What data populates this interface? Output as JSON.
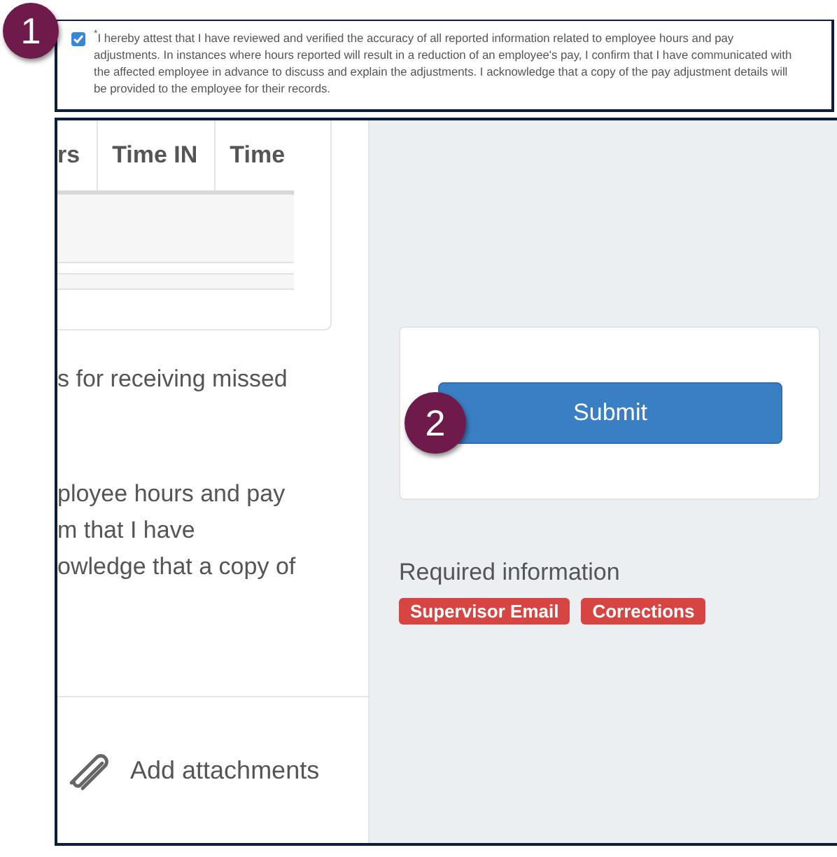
{
  "annotations": [
    {
      "label": "1"
    },
    {
      "label": "2"
    }
  ],
  "attestation": {
    "checked": true,
    "required_mark": "*",
    "text": "I hereby attest that I have reviewed and verified the accuracy of all reported information related to employee hours and pay adjustments. In instances where hours reported will result in a reduction of an employee's pay, I confirm that I have communicated with the affected employee in advance to discuss and explain the adjustments. I acknowledge that a copy of the pay adjustment details will be provided to the employee for their records."
  },
  "table": {
    "columns": [
      "rs",
      "Time IN",
      "Time"
    ]
  },
  "notice": {
    "line": "s for receiving missed"
  },
  "attestation_repeat": {
    "lines": [
      "ployee hours and pay",
      "m that I have",
      "owledge that a copy of"
    ]
  },
  "attachments": {
    "label": "Add attachments"
  },
  "submit": {
    "label": "Submit"
  },
  "required": {
    "title": "Required information",
    "tags": [
      "Supervisor Email",
      "Corrections"
    ]
  }
}
